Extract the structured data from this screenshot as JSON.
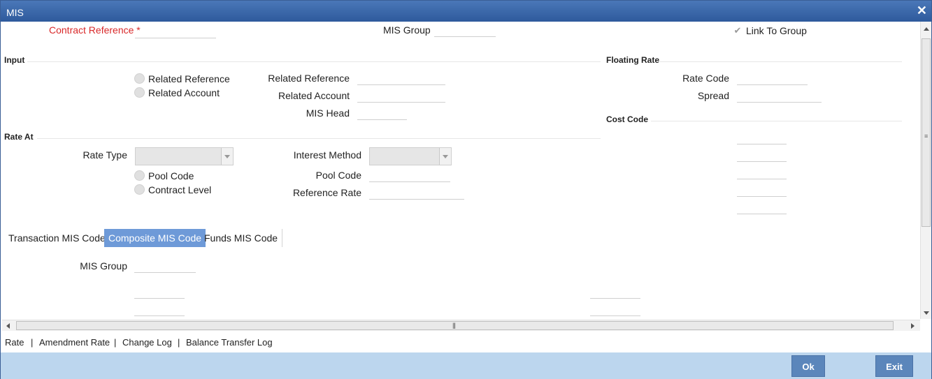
{
  "window": {
    "title": "MIS",
    "close_symbol": "✕"
  },
  "header": {
    "contract_reference_label": "Contract Reference",
    "required_mark": "*",
    "contract_reference_value": "",
    "mis_group_label": "MIS Group",
    "mis_group_value": "",
    "link_to_group_label": "Link To Group",
    "link_to_group_checked": true
  },
  "input_section": {
    "title": "Input",
    "radio_related_reference": "Related Reference",
    "radio_related_account": "Related Account",
    "related_reference_label": "Related Reference",
    "related_account_label": "Related Account",
    "mis_head_label": "MIS Head"
  },
  "floating_rate": {
    "title": "Floating Rate",
    "rate_code_label": "Rate Code",
    "spread_label": "Spread"
  },
  "cost_code": {
    "title": "Cost Code"
  },
  "rate_at": {
    "title": "Rate At",
    "rate_type_label": "Rate Type",
    "interest_method_label": "Interest Method",
    "radio_pool_code": "Pool Code",
    "radio_contract_level": "Contract Level",
    "pool_code_label": "Pool Code",
    "reference_rate_label": "Reference Rate"
  },
  "tabs": [
    {
      "label": "Transaction MIS Code",
      "active": false
    },
    {
      "label": "Composite MIS Code",
      "active": true
    },
    {
      "label": "Funds MIS Code",
      "active": false
    }
  ],
  "tab_content": {
    "mis_group_label": "MIS Group"
  },
  "footer_links": [
    "Rate",
    "Amendment Rate",
    "Change Log",
    "Balance Transfer Log"
  ],
  "footer_separator": "|",
  "buttons": {
    "ok": "Ok",
    "exit": "Exit"
  },
  "colors": {
    "title_bar": "#2e5a9c",
    "active_tab": "#6e9ad8",
    "button": "#5b86bb",
    "bottom_bar": "#bcd6ee",
    "required": "#d9292a"
  }
}
